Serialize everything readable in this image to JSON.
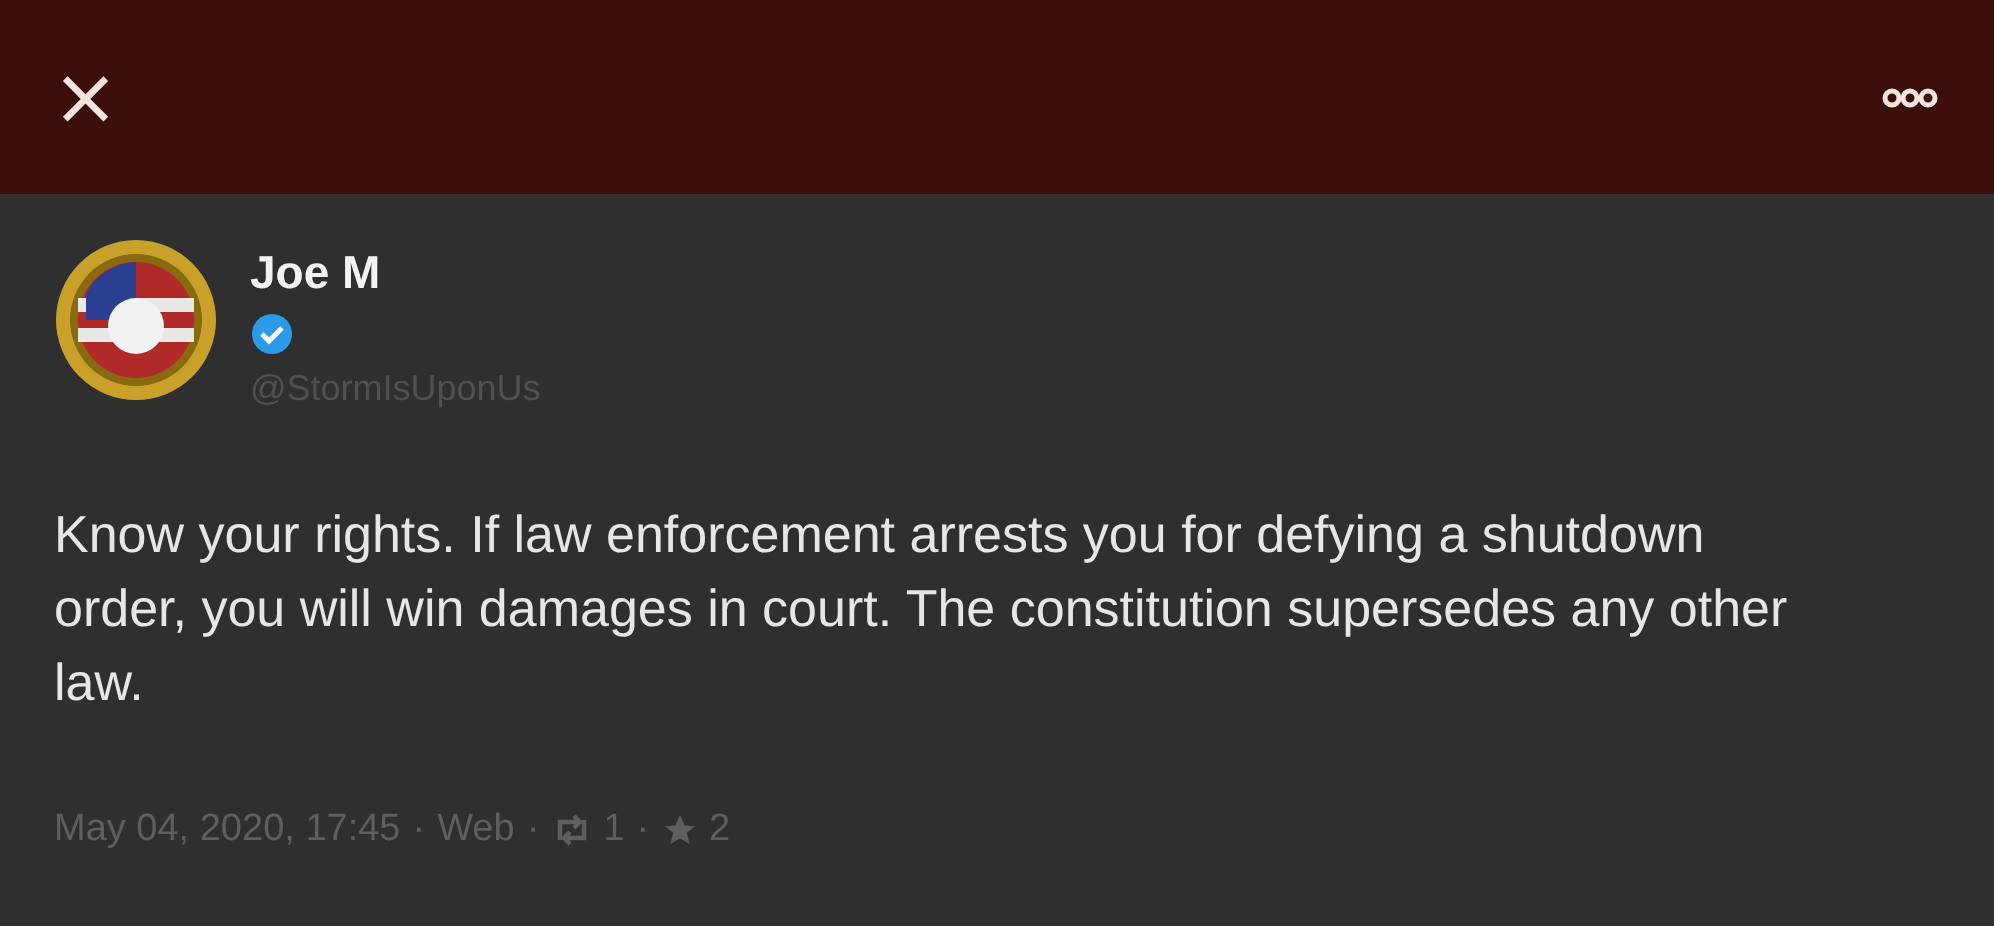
{
  "header": {
    "close": "×"
  },
  "post": {
    "author": "Joe M",
    "handle": "@StormIsUponUs",
    "text": "Know your rights. If law enforcement arrests you for defying a shutdown order, you will win damages in court. The constitution supersedes any other law.",
    "meta": [
      {
        "kind": "text",
        "label": "May 04, 2020, 17:45"
      },
      {
        "kind": "dot",
        "label": "·"
      },
      {
        "kind": "text",
        "label": "Web"
      },
      {
        "kind": "dot",
        "label": "·"
      },
      {
        "kind": "repost",
        "label": "1"
      },
      {
        "kind": "dot",
        "label": "·"
      },
      {
        "kind": "star",
        "label": "2"
      }
    ]
  }
}
